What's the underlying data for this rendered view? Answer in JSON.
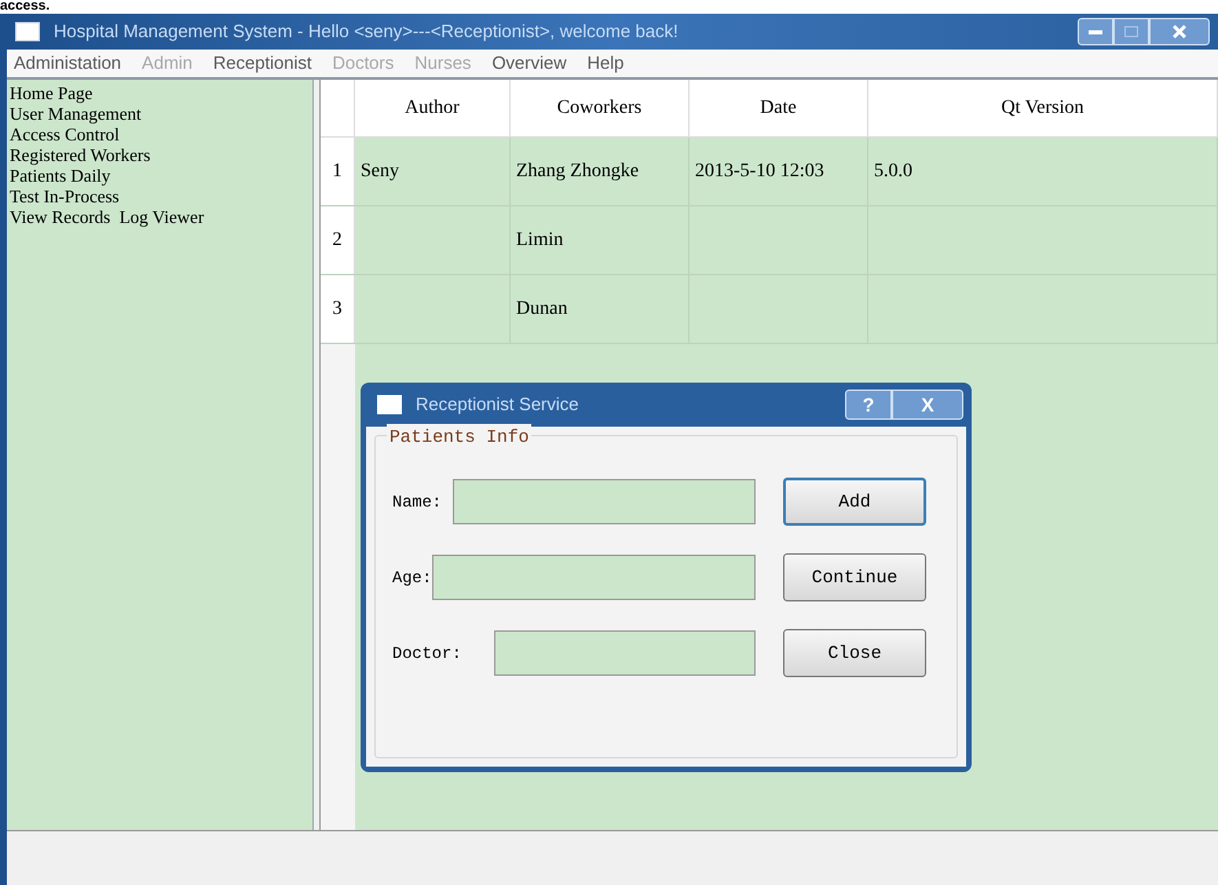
{
  "page_caption": {
    "text": "access."
  },
  "window": {
    "title": "Hospital Management System - Hello <seny>---<Receptionist>, welcome back!"
  },
  "menu": [
    {
      "label": "Administation",
      "disabled": false
    },
    {
      "label": "Admin",
      "disabled": true
    },
    {
      "label": "Receptionist",
      "disabled": false
    },
    {
      "label": "Doctors",
      "disabled": true
    },
    {
      "label": "Nurses",
      "disabled": true
    },
    {
      "label": "Overview",
      "disabled": false
    },
    {
      "label": "Help",
      "disabled": false
    }
  ],
  "sidebar": {
    "items": [
      "Home Page",
      "User Management",
      "Access Control",
      "Registered Workers",
      "Patients Daily",
      "Test In-Process",
      "View Records  Log Viewer"
    ]
  },
  "table": {
    "columns": [
      "Author",
      "Coworkers",
      "Date",
      "Qt Version"
    ],
    "rows": [
      {
        "number": "1",
        "cells": [
          "Seny",
          "Zhang Zhongke",
          "2013-5-10 12:03",
          "5.0.0"
        ]
      },
      {
        "number": "2",
        "cells": [
          "",
          "Limin",
          "",
          ""
        ]
      },
      {
        "number": "3",
        "cells": [
          "",
          "Dunan",
          "",
          ""
        ]
      }
    ]
  },
  "dialog": {
    "title": "Receptionist Service",
    "help": "?",
    "close": "X",
    "group": "Patients Info",
    "fields": [
      {
        "label": "Name:"
      },
      {
        "label": "Age:"
      },
      {
        "label": "Doctor:"
      }
    ],
    "buttons": [
      {
        "label": "Add",
        "default": true
      },
      {
        "label": "Continue",
        "default": false
      },
      {
        "label": "Close",
        "default": false
      }
    ]
  }
}
